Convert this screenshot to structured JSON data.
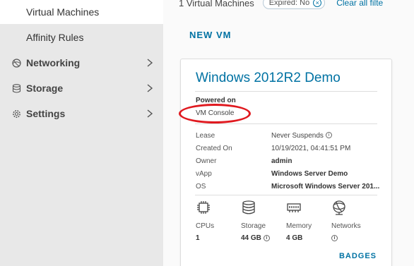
{
  "sidebar": {
    "items": [
      {
        "label": "Virtual Machines"
      },
      {
        "label": "Affinity Rules"
      },
      {
        "label": "Networking"
      },
      {
        "label": "Storage"
      },
      {
        "label": "Settings"
      }
    ]
  },
  "filters": {
    "count_text": "1 Virtual Machines",
    "chip_text": "Expired: No",
    "clear_all": "Clear all filte"
  },
  "actions": {
    "new_vm": "NEW VM"
  },
  "vm_card": {
    "title": "Windows 2012R2 Demo",
    "power_state": "Powered on",
    "console_link": "VM Console",
    "properties": [
      {
        "key": "Lease",
        "value": "Never Suspends"
      },
      {
        "key": "Created On",
        "value": "10/19/2021, 04:41:51 PM"
      },
      {
        "key": "Owner",
        "value": "admin"
      },
      {
        "key": "vApp",
        "value": "Windows Server Demo"
      },
      {
        "key": "OS",
        "value": "Microsoft Windows Server 201..."
      }
    ],
    "resources": [
      {
        "label": "CPUs",
        "value": "1",
        "icon": "cpu-icon"
      },
      {
        "label": "Storage",
        "value": "44 GB",
        "icon": "storage-icon"
      },
      {
        "label": "Memory",
        "value": "4 GB",
        "icon": "memory-icon"
      },
      {
        "label": "Networks",
        "value": "",
        "icon": "network-icon"
      }
    ],
    "badges_label": "BADGES"
  },
  "colors": {
    "link_blue": "#0072a3",
    "annotation_red": "#e0191f",
    "sidebar_bg": "#e8e8e8"
  }
}
